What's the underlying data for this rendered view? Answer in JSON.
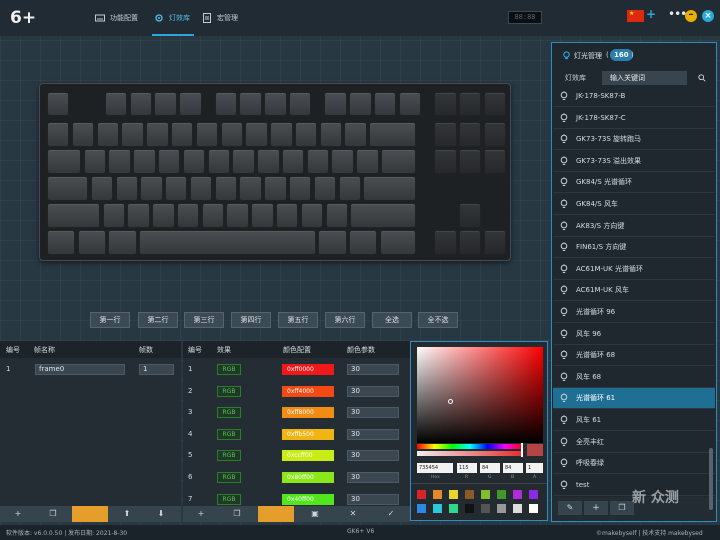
{
  "brand": {
    "logo_text": "6+"
  },
  "nav": [
    {
      "label": "功能配置",
      "icon": "keyboard-icon"
    },
    {
      "label": "灯效库",
      "icon": "gear-icon"
    },
    {
      "label": "宏管理",
      "icon": "document-icon"
    }
  ],
  "lcd_text": "88:88",
  "row_buttons": [
    "第一行",
    "第二行",
    "第三行",
    "第四行",
    "第五行",
    "第六行",
    "全选",
    "全不选"
  ],
  "frame_table": {
    "headers": [
      "编号",
      "帧名称",
      "帧数"
    ],
    "rows": [
      {
        "no": "1",
        "name": "frame0",
        "frames": "1"
      }
    ]
  },
  "effect_table": {
    "headers": [
      "编号",
      "效果",
      "颜色配置",
      "颜色参数"
    ],
    "rows": [
      {
        "no": "1",
        "effect": "RGB",
        "color_label": "0xff0000",
        "color": "#f01818",
        "param": "30"
      },
      {
        "no": "2",
        "effect": "RGB",
        "color_label": "0xff4000",
        "color": "#f24a12",
        "param": "30"
      },
      {
        "no": "3",
        "effect": "RGB",
        "color_label": "0xff8000",
        "color": "#f28c12",
        "param": "30"
      },
      {
        "no": "4",
        "effect": "RGB",
        "color_label": "0xffb500",
        "color": "#f0b513",
        "param": "30"
      },
      {
        "no": "5",
        "effect": "RGB",
        "color_label": "0xccff00",
        "color": "#c8ec16",
        "param": "30"
      },
      {
        "no": "6",
        "effect": "RGB",
        "color_label": "0x80ff00",
        "color": "#8ae81a",
        "param": "30"
      },
      {
        "no": "7",
        "effect": "RGB",
        "color_label": "0x40ff00",
        "color": "#52e61c",
        "param": "30"
      }
    ]
  },
  "picker": {
    "hex": "735454",
    "h": "115",
    "s": "84",
    "v": "84",
    "a": "1",
    "labels": [
      "Hex",
      "R",
      "G",
      "B",
      "A"
    ],
    "swatches": [
      "#d9232b",
      "#e5892b",
      "#e8d42b",
      "#8a5a2b",
      "#7fbf2b",
      "#3f9a2b",
      "#b02bd9",
      "#8a2be5",
      "#2b8ae5",
      "#2bc8d9",
      "#2bd98a",
      "#111111",
      "#555555",
      "#999999",
      "#dddddd",
      "#ffffff"
    ]
  },
  "frame_footer": [
    "+",
    "❐",
    "",
    "⬆",
    "⬇"
  ],
  "effect_footer": [
    "+",
    "❐",
    "",
    "▣",
    "✕",
    "✓"
  ],
  "right_panel": {
    "title": "灯光管理",
    "count": "160",
    "tabs": [
      "灯效库",
      "输入关键词"
    ],
    "items": [
      "JK-178-SK87-B",
      "JK-178-SK87-C",
      "GK73-73S 旋转跑马",
      "GK73-73S 溢出效果",
      "GK84/S 光谱循环",
      "GK84/S 风车",
      "AK83/S 方向键",
      "FIN61/S 方向键",
      "AC61M-UK 光谱循环",
      "AC61M-UK 风车",
      "光谱循环 96",
      "风车 96",
      "光谱循环 68",
      "风车 68",
      "光谱循环 61",
      "风车 61",
      "全亮丰红",
      "呼吸春绿",
      "test"
    ],
    "selected_index": 14
  },
  "status": {
    "version": "软件版本: v6.0.0.50 | 发布日期: 2021-8-30",
    "model": "GK6+ V6",
    "credit": "©makebyself | 技术支持 makebysed"
  },
  "watermark": "新 众测",
  "colors": {
    "accent": "#2fa6d8",
    "orange": "#e59d2c",
    "selected": "#1f6f95"
  }
}
